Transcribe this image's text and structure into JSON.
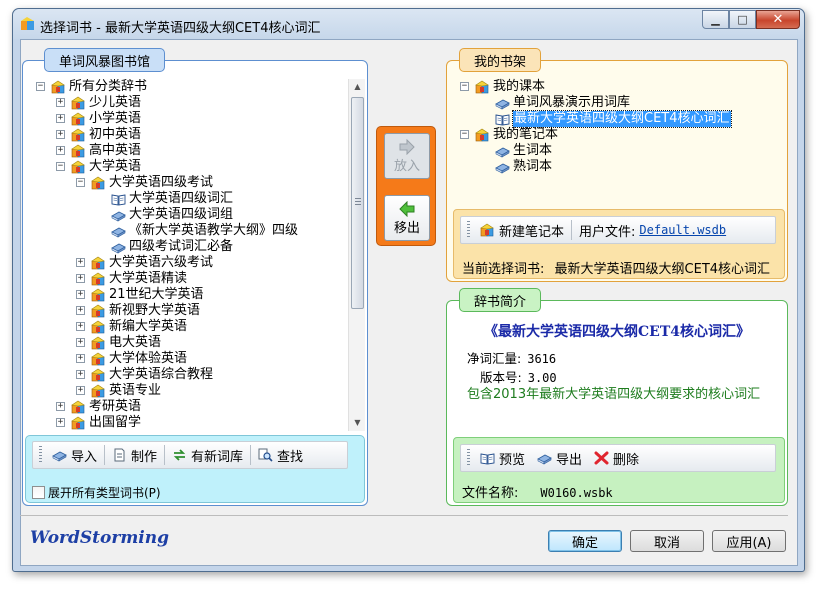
{
  "window": {
    "title": "选择词书 - 最新大学英语四级大纲CET4核心词汇",
    "minimize_glyph": "▁",
    "maximize_glyph": "□",
    "close_glyph": "✕"
  },
  "library": {
    "title": "单词风暴图书馆",
    "tree": [
      {
        "label": "所有分类辞书",
        "icon": "category-cube-icon",
        "toggle": "−"
      },
      {
        "label": "少儿英语",
        "icon": "category-cube-icon",
        "toggle": "+"
      },
      {
        "label": "小学英语",
        "icon": "category-cube-icon",
        "toggle": "+"
      },
      {
        "label": "初中英语",
        "icon": "category-cube-icon",
        "toggle": "+"
      },
      {
        "label": "高中英语",
        "icon": "category-cube-icon",
        "toggle": "+"
      },
      {
        "label": "大学英语",
        "icon": "category-cube-icon",
        "toggle": "−"
      },
      {
        "label": "大学英语四级考试",
        "icon": "category-cube-icon",
        "toggle": "−"
      },
      {
        "label": "大学英语四级词汇",
        "icon": "open-book-icon",
        "toggle": ""
      },
      {
        "label": "大学英语四级词组",
        "icon": "closed-book-icon",
        "toggle": ""
      },
      {
        "label": "《新大学英语教学大纲》四级",
        "icon": "closed-book-icon",
        "toggle": ""
      },
      {
        "label": "四级考试词汇必备",
        "icon": "closed-book-icon",
        "toggle": ""
      },
      {
        "label": "大学英语六级考试",
        "icon": "category-cube-icon",
        "toggle": "+"
      },
      {
        "label": "大学英语精读",
        "icon": "category-cube-icon",
        "toggle": "+"
      },
      {
        "label": "21世纪大学英语",
        "icon": "category-cube-icon",
        "toggle": "+"
      },
      {
        "label": "新视野大学英语",
        "icon": "category-cube-icon",
        "toggle": "+"
      },
      {
        "label": "新编大学英语",
        "icon": "category-cube-icon",
        "toggle": "+"
      },
      {
        "label": "电大英语",
        "icon": "category-cube-icon",
        "toggle": "+"
      },
      {
        "label": "大学体验英语",
        "icon": "category-cube-icon",
        "toggle": "+"
      },
      {
        "label": "大学英语综合教程",
        "icon": "category-cube-icon",
        "toggle": "+"
      },
      {
        "label": "英语专业",
        "icon": "category-cube-icon",
        "toggle": "+"
      },
      {
        "label": "考研英语",
        "icon": "category-cube-icon",
        "toggle": "+"
      },
      {
        "label": "出国留学",
        "icon": "category-cube-icon",
        "toggle": "+"
      }
    ],
    "toolbar": {
      "import_label": "导入",
      "make_label": "制作",
      "new_dict_label": "有新词库",
      "find_label": "查找"
    },
    "expand_all_label": "展开所有类型词书(P)"
  },
  "transfer": {
    "put_label": "放入",
    "move_out_label": "移出"
  },
  "shelf": {
    "title": "我的书架",
    "tree": [
      {
        "label": "我的课本",
        "icon": "category-cube-icon",
        "toggle": "−"
      },
      {
        "label": "单词风暴演示用词库",
        "icon": "closed-book-icon",
        "toggle": ""
      },
      {
        "label": "最新大学英语四级大纲CET4核心词汇",
        "icon": "open-book-icon",
        "toggle": "",
        "selected": true
      },
      {
        "label": "我的笔记本",
        "icon": "category-cube-icon",
        "toggle": "−"
      },
      {
        "label": "生词本",
        "icon": "closed-book-icon",
        "toggle": ""
      },
      {
        "label": "熟词本",
        "icon": "closed-book-icon",
        "toggle": ""
      }
    ],
    "new_notebook_label": "新建笔记本",
    "user_file_label": "用户文件:",
    "user_file_value": "Default.wsdb",
    "current_label": "当前选择词书:",
    "current_value": "最新大学英语四级大纲CET4核心词汇"
  },
  "dict_info": {
    "title": "辞书简介",
    "book_title": "《最新大学英语四级大纲CET4核心词汇》",
    "word_count_label": "净词汇量:",
    "word_count_value": "3616",
    "version_label": "版本号:",
    "version_value": "3.00",
    "description": "包含2013年最新大学英语四级大纲要求的核心词汇",
    "preview_label": "预览",
    "export_label": "导出",
    "delete_label": "删除",
    "filename_label": "文件名称:",
    "filename_value": "W0160.wsbk"
  },
  "footer": {
    "brand": "WordStorming",
    "ok_label": "确定",
    "cancel_label": "取消",
    "apply_label": "应用(A)"
  },
  "colors": {
    "accent_blue": "#5d8fd0",
    "shelf_orange": "#e2a23b",
    "info_green": "#5bb95b",
    "transfer_orange": "#f57a19",
    "selection": "#3399ff"
  }
}
